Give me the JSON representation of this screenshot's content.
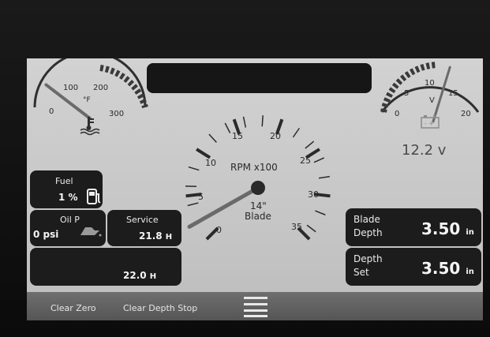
{
  "temperature_gauge": {
    "ticks": [
      "0",
      "100",
      "200",
      "300"
    ],
    "unit": "°F",
    "icon": "coolant-temp-icon",
    "needle_value": 60,
    "min": 0,
    "max": 350
  },
  "voltage_gauge": {
    "ticks": [
      "0",
      "5",
      "10",
      "15",
      "20"
    ],
    "unit": "V",
    "icon": "battery-icon",
    "needle_value": 12.2,
    "min": 0,
    "max": 20,
    "readout": "12.2 v"
  },
  "rpm_gauge": {
    "ticks": [
      "0",
      "5",
      "10",
      "15",
      "20",
      "25",
      "30",
      "35"
    ],
    "label": "RPM x100",
    "needle_value": 2,
    "min": 0,
    "max": 35,
    "sub_value": "14\"",
    "sub_label": "Blade"
  },
  "fuel": {
    "label": "Fuel",
    "value": "1 %",
    "icon": "fuel-pump-icon"
  },
  "oil_pressure": {
    "label": "Oil P",
    "value": "0 psi",
    "icon": "oil-can-icon"
  },
  "service": {
    "label": "Service",
    "value": "21.8",
    "unit": "H"
  },
  "hours": {
    "value": "22.0",
    "unit": "H"
  },
  "blade_depth": {
    "label_line1": "Blade",
    "label_line2": "Depth",
    "value": "3.50",
    "unit": "in"
  },
  "depth_set": {
    "label_line1": "Depth",
    "label_line2": "Set",
    "value": "3.50",
    "unit": "in"
  },
  "bottom_bar": {
    "btn1": "Clear Zero",
    "btn2": "Clear Depth Stop",
    "menu_icon": "menu-icon"
  },
  "colors": {
    "panel": "#1c1c1c",
    "screen": "#c8c8c8",
    "needle": "#6a6a6a",
    "hub": "#2a2a2a"
  }
}
